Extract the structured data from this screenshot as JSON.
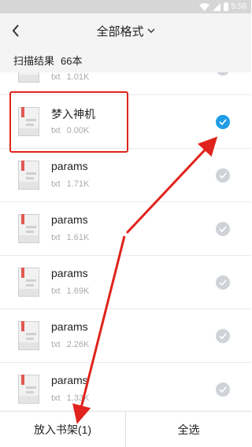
{
  "status_bar": {
    "time": "5:58"
  },
  "nav": {
    "title": "全部格式"
  },
  "result": {
    "label": "扫描结果",
    "count": "66本"
  },
  "files": [
    {
      "name": "",
      "type": "txt",
      "size": "1.01K",
      "checked": false
    },
    {
      "name": "梦入神机",
      "type": "txt",
      "size": "0.00K",
      "checked": true
    },
    {
      "name": "params",
      "type": "txt",
      "size": "1.71K",
      "checked": false
    },
    {
      "name": "params",
      "type": "txt",
      "size": "1.61K",
      "checked": false
    },
    {
      "name": "params",
      "type": "txt",
      "size": "1.69K",
      "checked": false
    },
    {
      "name": "params",
      "type": "txt",
      "size": "2.26K",
      "checked": false
    },
    {
      "name": "params",
      "type": "txt",
      "size": "1.33K",
      "checked": false
    }
  ],
  "bottom": {
    "add_label": "放入书架(1)",
    "select_all_label": "全选"
  },
  "colors": {
    "accent": "#1e9de6",
    "annotation": "#e0231c"
  }
}
